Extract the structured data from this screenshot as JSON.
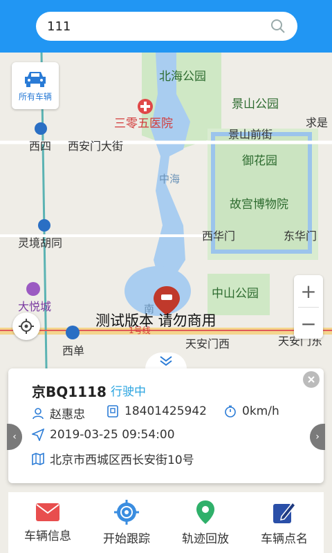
{
  "search": {
    "value": "111"
  },
  "map": {
    "labels": {
      "beihai": "北海公园",
      "hospital": "三零五医院",
      "jingshan": "景山公园",
      "jingshan_st": "景山前街",
      "qiushi": "求是",
      "xisi": "西四",
      "xianmen": "西安门大街",
      "zhonghai": "中海",
      "yuhuayuan": "御花园",
      "gugong": "故宫博物院",
      "lingjing": "灵境胡同",
      "xihuamen": "西华门",
      "donghuamen": "东华门",
      "dayuecheng": "大悦城",
      "zhongshan": "中山公园",
      "nan": "南",
      "line1": "1号线",
      "tiananmenxi": "天安门西",
      "tiananmendong": "天安门东",
      "xidan": "西单"
    },
    "watermark": "测试版本  请勿商用"
  },
  "all_vehicles": {
    "label": "所有车辆"
  },
  "vehicle": {
    "plate": "京BQ1118",
    "status": "行驶中",
    "driver": "赵惠忠",
    "phone": "18401425942",
    "speed": "0km/h",
    "time": "2019-03-25 09:54:00",
    "address": "北京市西城区西长安街10号"
  },
  "toolbar": {
    "info": "车辆信息",
    "track": "开始跟踪",
    "playback": "轨迹回放",
    "rollcall": "车辆点名"
  },
  "colors": {
    "primary": "#2196f3",
    "status": "#2aa4e0",
    "water": "#a9cdf0",
    "park": "#cfe8c5"
  }
}
